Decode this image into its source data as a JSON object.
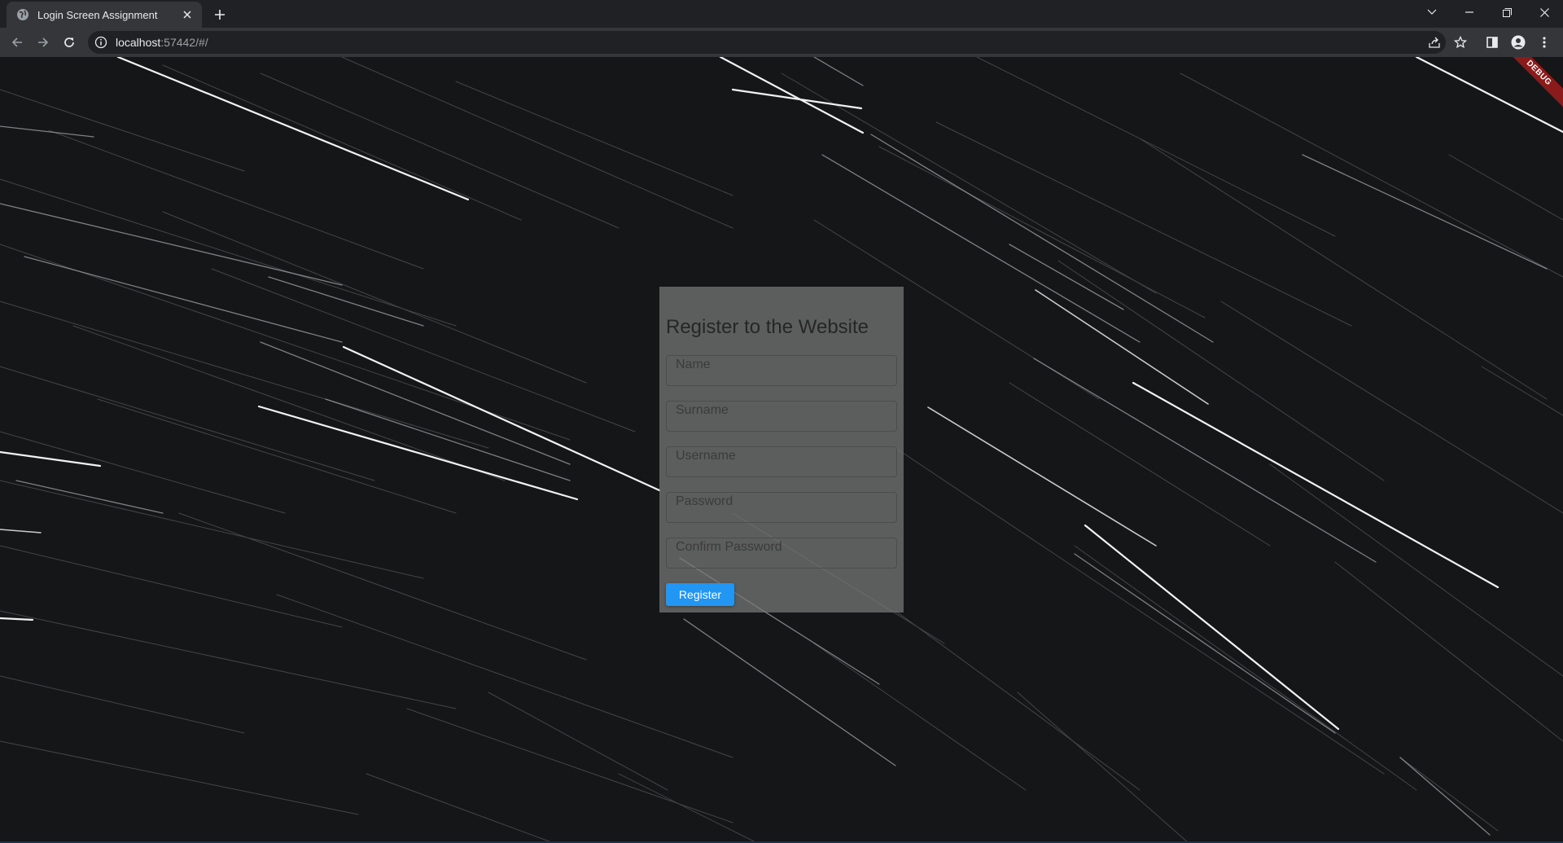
{
  "browser": {
    "tab_title": "Login Screen Assignment",
    "url_host": "localhost",
    "url_rest": ":57442/#/"
  },
  "page": {
    "debug_banner": "DEBUG",
    "form": {
      "heading": "Register to the Website",
      "fields": [
        {
          "placeholder": "Name",
          "value": ""
        },
        {
          "placeholder": "Surname",
          "value": ""
        },
        {
          "placeholder": "Username",
          "value": ""
        },
        {
          "placeholder": "Password",
          "value": ""
        },
        {
          "placeholder": "Confirm Password",
          "value": ""
        }
      ],
      "submit_label": "Register"
    }
  },
  "colors": {
    "accent": "#2196f3",
    "debug_banner": "#8b1a1a",
    "card": "#787878"
  },
  "icons": {
    "favicon": "globe-icon",
    "tab_close": "close-icon",
    "new_tab": "plus-icon",
    "back": "arrow-left-icon",
    "forward": "arrow-right-icon",
    "reload": "reload-icon",
    "site_info": "info-icon",
    "share": "share-icon",
    "bookmark": "star-icon",
    "side_panel": "side-panel-icon",
    "profile": "profile-icon",
    "menu": "kebab-menu-icon"
  }
}
